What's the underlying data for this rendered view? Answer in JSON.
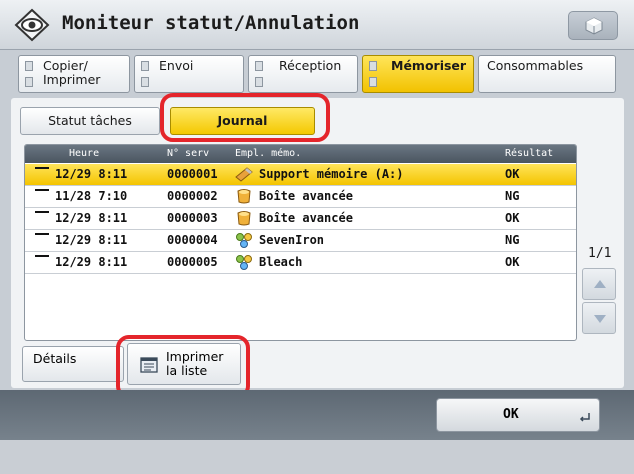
{
  "window": {
    "title": "Moniteur statut/Annulation"
  },
  "tabs": [
    {
      "label": "Copier/\nImprimer",
      "active": false
    },
    {
      "label": "Envoi",
      "active": false
    },
    {
      "label": "Réception",
      "active": false
    },
    {
      "label": "Mémoriser",
      "active": true
    },
    {
      "label": "Consommables",
      "active": false
    }
  ],
  "subtabs": {
    "status": "Statut tâches",
    "journal": "Journal"
  },
  "table": {
    "headers": {
      "time": "Heure",
      "num": "N° serv",
      "location": "Empl. mémo.",
      "result": "Résultat"
    },
    "rows": [
      {
        "time": "12/29 8:11",
        "num": "0000001",
        "location": "Support mémoire (A:)",
        "result": "OK",
        "icon": "memory-stick-icon",
        "selected": true
      },
      {
        "time": "11/28 7:10",
        "num": "0000002",
        "location": "Boîte avancée",
        "result": "NG",
        "icon": "advanced-box-icon",
        "selected": false
      },
      {
        "time": "12/29 8:11",
        "num": "0000003",
        "location": "Boîte avancée",
        "result": "OK",
        "icon": "advanced-box-icon",
        "selected": false
      },
      {
        "time": "12/29 8:11",
        "num": "0000004",
        "location": "SevenIron",
        "result": "NG",
        "icon": "network-icon",
        "selected": false
      },
      {
        "time": "12/29 8:11",
        "num": "0000005",
        "location": "Bleach",
        "result": "OK",
        "icon": "network-icon",
        "selected": false
      }
    ]
  },
  "pagination": {
    "indicator": "1/1"
  },
  "buttons": {
    "details": "Détails",
    "print_list": "Imprimer\nla liste",
    "ok": "OK"
  },
  "colors": {
    "accent_yellow": "#f4c800",
    "highlight_red": "#e4252b"
  }
}
